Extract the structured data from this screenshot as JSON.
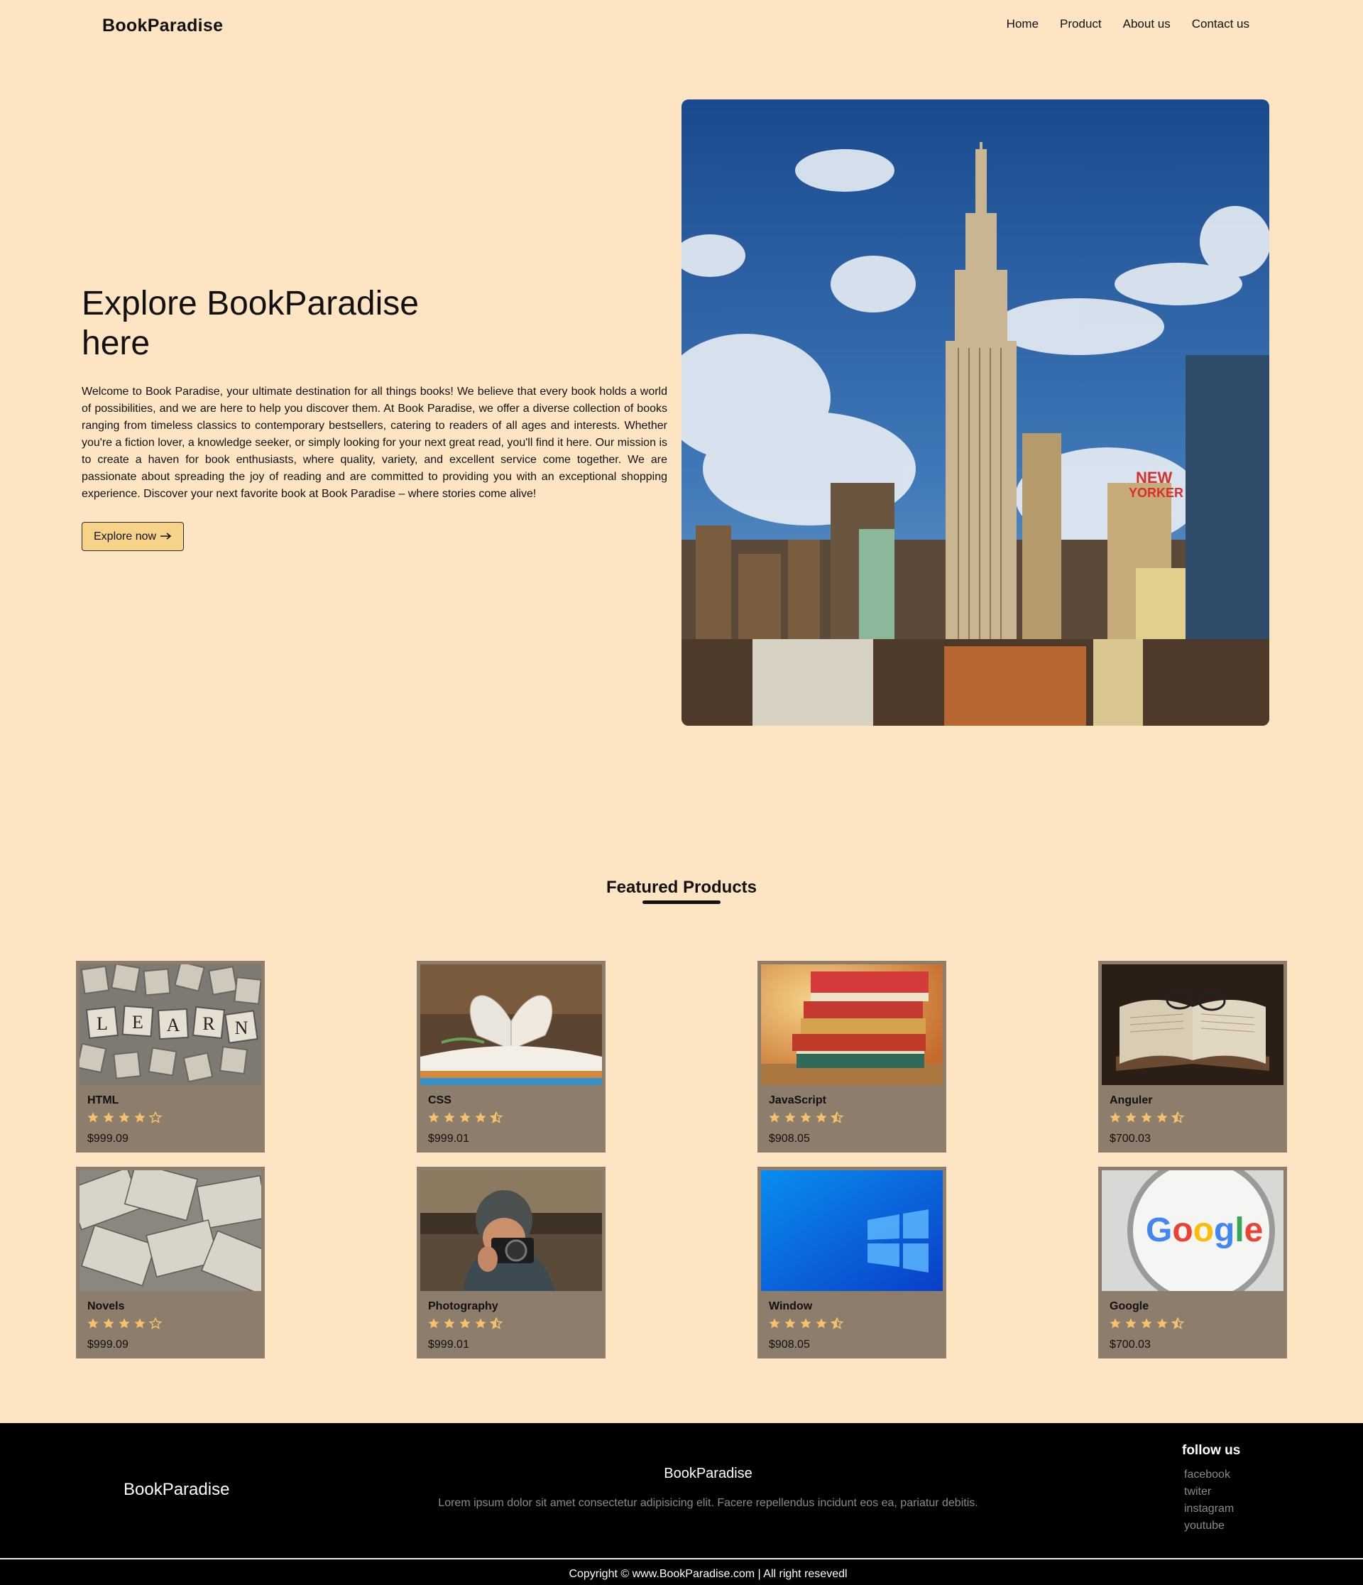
{
  "nav": {
    "brand": "BookParadise",
    "links": [
      "Home",
      "Product",
      "About us",
      "Contact us"
    ]
  },
  "hero": {
    "title": "Explore BookParadise here",
    "text": "Welcome to Book Paradise, your ultimate destination for all things books! We believe that every book holds a world of possibilities, and we are here to help you discover them. At Book Paradise, we offer a diverse collection of books ranging from timeless classics to contemporary bestsellers, catering to readers of all ages and interests. Whether you're a fiction lover, a knowledge seeker, or simply looking for your next great read, you'll find it here. Our mission is to create a haven for book enthusiasts, where quality, variety, and excellent service come together. We are passionate about spreading the joy of reading and are committed to providing you with an exceptional shopping experience. Discover your next favorite book at Book Paradise – where stories come alive!",
    "button_label": "Explore now",
    "button_icon": "arrow-right-icon",
    "image": "city-skyline-photo"
  },
  "featured": {
    "title": "Featured Products",
    "products": [
      {
        "name": "HTML",
        "rating": 4,
        "price": "$999.09",
        "image": "scrabble-learn-tiles"
      },
      {
        "name": "CSS",
        "rating": 4.5,
        "price": "$999.01",
        "image": "book-heart-pages"
      },
      {
        "name": "JavaScript",
        "rating": 4.5,
        "price": "$908.05",
        "image": "stacked-books"
      },
      {
        "name": "Anguler",
        "rating": 4.5,
        "price": "$700.03",
        "image": "open-book-glasses"
      },
      {
        "name": "Novels",
        "rating": 4,
        "price": "$999.09",
        "image": "scattered-open-books"
      },
      {
        "name": "Photography",
        "rating": 4.5,
        "price": "$999.01",
        "image": "person-with-camera"
      },
      {
        "name": "Window",
        "rating": 4.5,
        "price": "$908.05",
        "image": "windows-wallpaper"
      },
      {
        "name": "Google",
        "rating": 4.5,
        "price": "$700.03",
        "image": "google-logo-magnifier"
      }
    ]
  },
  "footer": {
    "brand": "BookParadise",
    "center_title": "BookParadise",
    "center_text": "Lorem ipsum dolor sit amet consectetur adipisicing elit. Facere repellendus incidunt eos ea, pariatur debitis.",
    "follow_title": "follow us",
    "follow_links": [
      "facebook",
      "twiter",
      "instagram",
      "youtube"
    ],
    "copyright": "Copyright © www.BookParadise.com | All right resevedl"
  },
  "colors": {
    "page_bg": "#fde4c3",
    "card_bg": "#8d7d6c",
    "star": "#f5c26b",
    "button_bg": "#f7d38a",
    "footer_bg": "#000000"
  }
}
